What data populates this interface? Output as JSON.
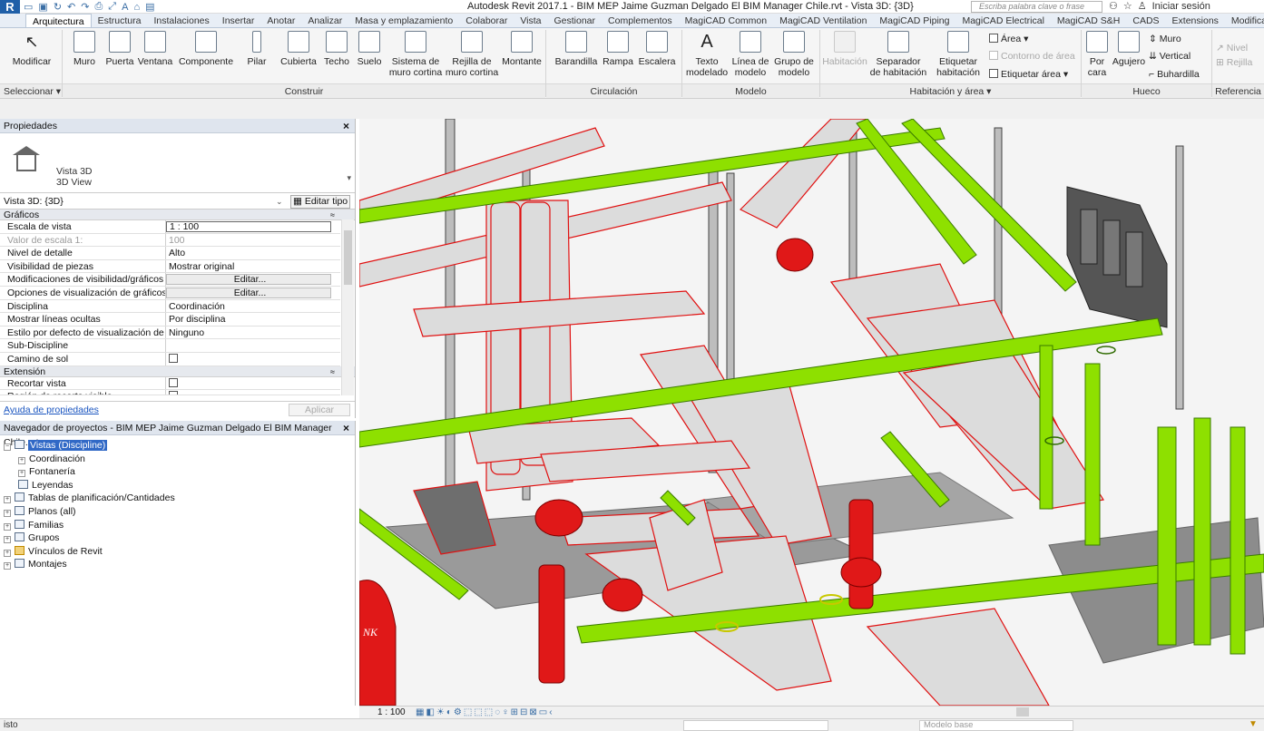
{
  "titlebar": {
    "app_letter": "R",
    "qat_icons": [
      "open-icon",
      "save-icon",
      "sync-icon",
      "undo-icon",
      "redo-icon",
      "print-icon",
      "measure-icon",
      "text-icon",
      "home-icon",
      "window-icon"
    ],
    "document_title": "Autodesk Revit 2017.1 -    BIM MEP Jaime Guzman Delgado El BIM Manager Chile.rvt - Vista 3D: {3D}",
    "search_placeholder": "Escriba palabra clave o frase",
    "sign_in": "Iniciar sesión"
  },
  "tabs": [
    "Arquitectura",
    "Estructura",
    "Instalaciones",
    "Insertar",
    "Anotar",
    "Analizar",
    "Masa y emplazamiento",
    "Colaborar",
    "Vista",
    "Gestionar",
    "Complementos",
    "MagiCAD Common",
    "MagiCAD Ventilation",
    "MagiCAD Piping",
    "MagiCAD Electrical",
    "MagiCAD S&H",
    "CADS",
    "Extensions",
    "Modificar"
  ],
  "ribbon": {
    "modificar": "Modificar",
    "construir": {
      "muro": "Muro",
      "puerta": "Puerta",
      "ventana": "Ventana",
      "componente": "Componente",
      "pilar": "Pilar",
      "cubierta": "Cubierta",
      "techo": "Techo",
      "suelo": "Suelo",
      "sistema_1": "Sistema de",
      "sistema_2": "muro cortina",
      "rejilla_1": "Rejilla de",
      "rejilla_2": "muro cortina",
      "montante": "Montante"
    },
    "circulacion": {
      "barandilla": "Barandilla",
      "rampa": "Rampa",
      "escalera": "Escalera"
    },
    "modelo": {
      "texto_1": "Texto",
      "texto_2": "modelado",
      "linea_1": "Línea de",
      "linea_2": "modelo",
      "grupo_1": "Grupo de",
      "grupo_2": "modelo"
    },
    "habitacion": {
      "habitacion": "Habitación",
      "separador_1": "Separador",
      "separador_2": "de habitación",
      "etiquetar_1": "Etiquetar",
      "etiquetar_2": "habitación",
      "area": "Área",
      "contorno": "Contorno de área",
      "etiquetar_area": "Etiquetar área"
    },
    "hueco": {
      "por_1": "Por",
      "por_2": "cara",
      "agujero": "Agujero",
      "muro": "Muro",
      "vertical": "Vertical",
      "buhardilla": "Buhardilla"
    },
    "referencia": {
      "nivel": "Nivel",
      "rejilla": "Rejilla"
    },
    "groups": {
      "seleccionar": "Seleccionar",
      "construir": "Construir",
      "circulacion": "Circulación",
      "modelo": "Modelo",
      "habitacion": "Habitación y área",
      "hueco": "Hueco",
      "referencia": "Referencia"
    }
  },
  "properties": {
    "title": "Propiedades",
    "type_line1": "Vista 3D",
    "type_line2": "3D View",
    "instance": "Vista 3D: {3D}",
    "edit_type": "Editar tipo",
    "group_graficos": "Gráficos",
    "group_extension": "Extensión",
    "rows": [
      {
        "k": "Escala de vista",
        "v": "1 : 100"
      },
      {
        "k": "Valor de escala    1:",
        "v": "100"
      },
      {
        "k": "Nivel de detalle",
        "v": "Alto"
      },
      {
        "k": "Visibilidad de piezas",
        "v": "Mostrar original"
      },
      {
        "k": "Modificaciones de visibilidad/gráficos",
        "v": "Editar..."
      },
      {
        "k": "Opciones de visualización de gráficos",
        "v": "Editar..."
      },
      {
        "k": "Disciplina",
        "v": "Coordinación"
      },
      {
        "k": "Mostrar líneas ocultas",
        "v": "Por disciplina"
      },
      {
        "k": "Estilo por defecto de visualización de a...",
        "v": "Ninguno"
      },
      {
        "k": "Sub-Discipline",
        "v": ""
      },
      {
        "k": "Camino de sol",
        "v": ""
      }
    ],
    "ext_rows": [
      {
        "k": "Recortar vista",
        "v": ""
      },
      {
        "k": "Región de recorte visible",
        "v": ""
      }
    ],
    "help_link": "Ayuda de propiedades",
    "apply": "Aplicar"
  },
  "browser": {
    "title": "Navegador de proyectos - BIM MEP Jaime Guzman Delgado El BIM Manager Chile.rvt",
    "items": [
      {
        "label": "Vistas (Discipline)",
        "level": 0,
        "sign": "−",
        "icon": "views-icon"
      },
      {
        "label": "Coordinación",
        "level": 1,
        "sign": "+",
        "icon": ""
      },
      {
        "label": "Fontanería",
        "level": 1,
        "sign": "+",
        "icon": ""
      },
      {
        "label": "Leyendas",
        "level": 0,
        "sign": "",
        "icon": "legend-icon"
      },
      {
        "label": "Tablas de planificación/Cantidades",
        "level": 0,
        "sign": "+",
        "icon": "schedule-icon"
      },
      {
        "label": "Planos (all)",
        "level": 0,
        "sign": "+",
        "icon": "sheet-icon"
      },
      {
        "label": "Familias",
        "level": 0,
        "sign": "+",
        "icon": "family-icon"
      },
      {
        "label": "Grupos",
        "level": 0,
        "sign": "+",
        "icon": "group-icon"
      },
      {
        "label": "Vínculos de Revit",
        "level": 0,
        "sign": "+",
        "icon": "link-icon"
      },
      {
        "label": "Montajes",
        "level": 0,
        "sign": "+",
        "icon": "assembly-icon"
      }
    ]
  },
  "viewbar": {
    "scale": "1 : 100",
    "tank_text": "NK"
  },
  "status": {
    "text": "isto",
    "model": "Modelo base"
  },
  "colors": {
    "pipe_green": "#8ee000",
    "pipe_gray": "#d8d8d8",
    "pipe_red_outline": "#e01010",
    "selection": "#3169c6",
    "equipment_red": "#e01818"
  }
}
